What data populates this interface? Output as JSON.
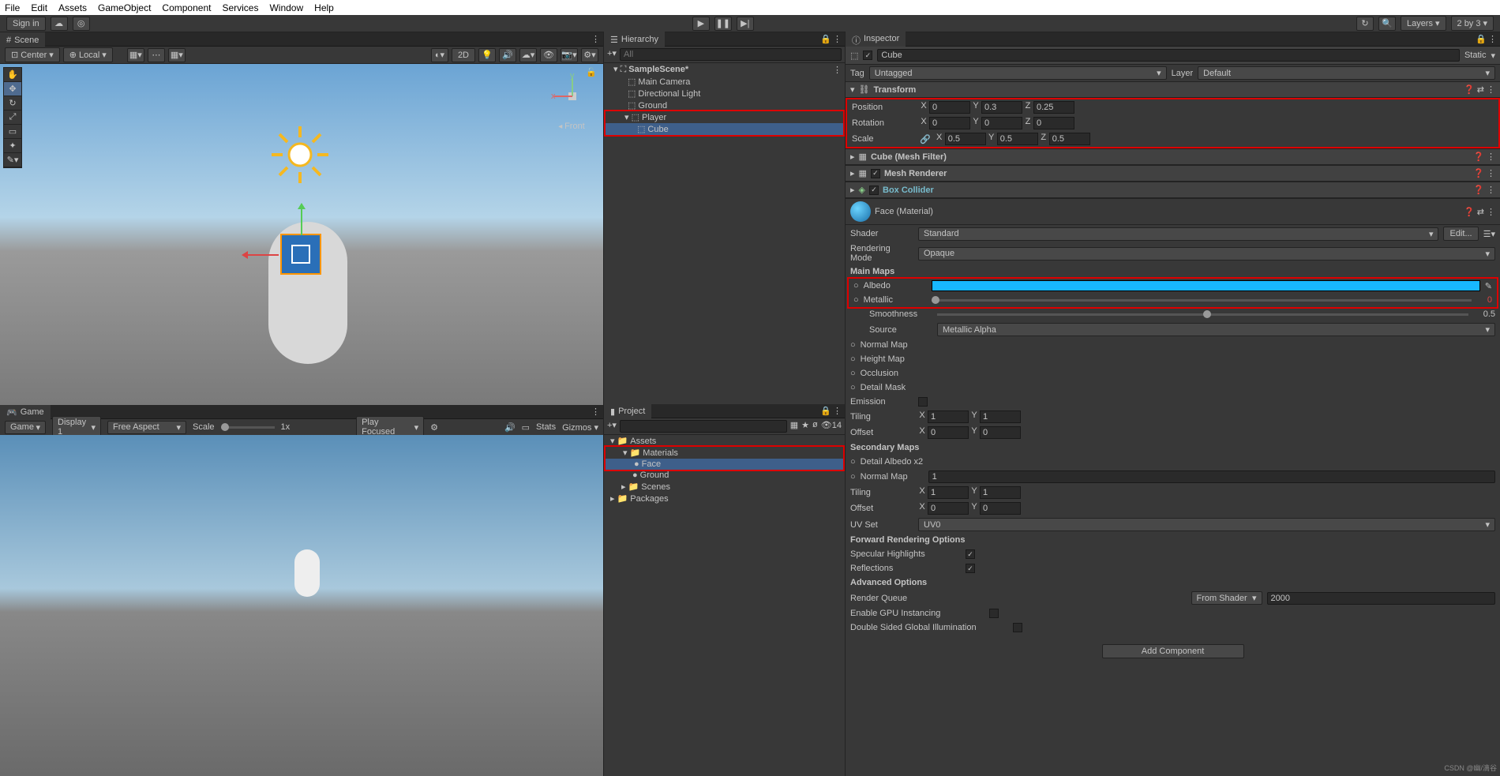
{
  "menu": {
    "items": [
      "File",
      "Edit",
      "Assets",
      "GameObject",
      "Component",
      "Services",
      "Window",
      "Help"
    ]
  },
  "topbar": {
    "signin": "Sign in",
    "layers": "Layers",
    "layout": "2 by 3"
  },
  "scene": {
    "tab": "Scene",
    "center": "Center",
    "local": "Local",
    "mode2d": "2D",
    "front": "Front"
  },
  "hierarchy": {
    "tab": "Hierarchy",
    "search": "All",
    "root": "SampleScene*",
    "items": [
      "Main Camera",
      "Directional Light",
      "Ground",
      "Player",
      "Cube"
    ]
  },
  "game": {
    "tab": "Game",
    "game": "Game",
    "display": "Display 1",
    "aspect": "Free Aspect",
    "scale": "Scale",
    "scaleVal": "1x",
    "play": "Play Focused",
    "stats": "Stats",
    "gizmos": "Gizmos"
  },
  "project": {
    "tab": "Project",
    "assets": "Assets",
    "materials": "Materials",
    "face": "Face",
    "ground": "Ground",
    "scenes": "Scenes",
    "packages": "Packages",
    "count": "14"
  },
  "inspector": {
    "tab": "Inspector",
    "name": "Cube",
    "static": "Static",
    "tag": "Tag",
    "tagVal": "Untagged",
    "layer": "Layer",
    "layerVal": "Default",
    "transform": "Transform",
    "position": "Position",
    "rotation": "Rotation",
    "scale": "Scale",
    "pos": {
      "x": "0",
      "y": "0.3",
      "z": "0.25"
    },
    "rot": {
      "x": "0",
      "y": "0",
      "z": "0"
    },
    "scl": {
      "x": "0.5",
      "y": "0.5",
      "z": "0.5"
    },
    "meshfilter": "Cube (Mesh Filter)",
    "meshrenderer": "Mesh Renderer",
    "boxcollider": "Box Collider",
    "material": "Face (Material)",
    "shader": "Shader",
    "shaderVal": "Standard",
    "edit": "Edit...",
    "renderMode": "Rendering Mode",
    "renderModeVal": "Opaque",
    "mainMaps": "Main Maps",
    "albedo": "Albedo",
    "metallic": "Metallic",
    "smoothness": "Smoothness",
    "smoothVal": "0.5",
    "source": "Source",
    "sourceVal": "Metallic Alpha",
    "normalMap": "Normal Map",
    "heightMap": "Height Map",
    "occlusion": "Occlusion",
    "detailMask": "Detail Mask",
    "emission": "Emission",
    "tiling": "Tiling",
    "offset": "Offset",
    "tilX": "1",
    "tilY": "1",
    "offX": "0",
    "offY": "0",
    "secondary": "Secondary Maps",
    "detailAlbedo": "Detail Albedo x2",
    "normalMap2": "Normal Map",
    "nmVal": "1",
    "tilX2": "1",
    "tilY2": "1",
    "offX2": "0",
    "offY2": "0",
    "uvset": "UV Set",
    "uvVal": "UV0",
    "forward": "Forward Rendering Options",
    "specular": "Specular Highlights",
    "reflections": "Reflections",
    "advanced": "Advanced Options",
    "renderQueue": "Render Queue",
    "fromShader": "From Shader",
    "queueVal": "2000",
    "gpuInst": "Enable GPU Instancing",
    "doubleSided": "Double Sided Global Illumination",
    "addComp": "Add Component"
  },
  "watermark": "CSDN @幽/滴谷"
}
